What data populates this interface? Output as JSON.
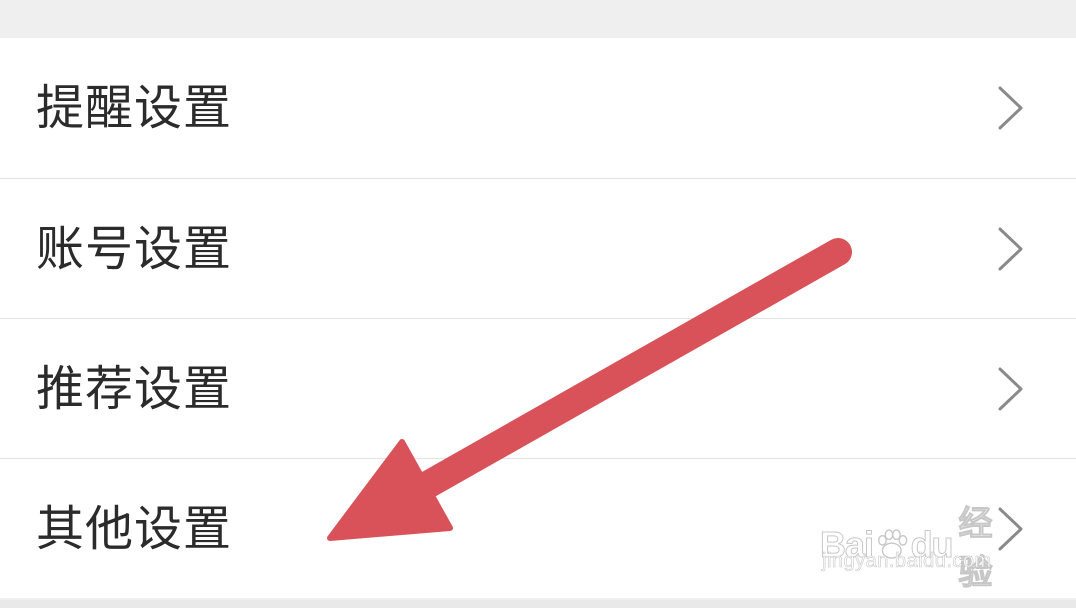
{
  "settings_list": {
    "items": [
      {
        "label": "提醒设置",
        "icon": "chevron-right-icon"
      },
      {
        "label": "账号设置",
        "icon": "chevron-right-icon"
      },
      {
        "label": "推荐设置",
        "icon": "chevron-right-icon"
      },
      {
        "label": "其他设置",
        "icon": "chevron-right-icon"
      }
    ]
  },
  "annotation": {
    "type": "arrow",
    "color": "#d9525a",
    "points_to": "其他设置"
  },
  "watermark": {
    "brand_prefix": "Bai",
    "brand_suffix": "du",
    "brand_cn": "经验",
    "url": "jingyan.baidu.com"
  },
  "colors": {
    "background": "#efefef",
    "row_background": "#ffffff",
    "divider": "#e3e3e3",
    "text": "#2b2b2b",
    "chevron": "#8a8a8a"
  }
}
